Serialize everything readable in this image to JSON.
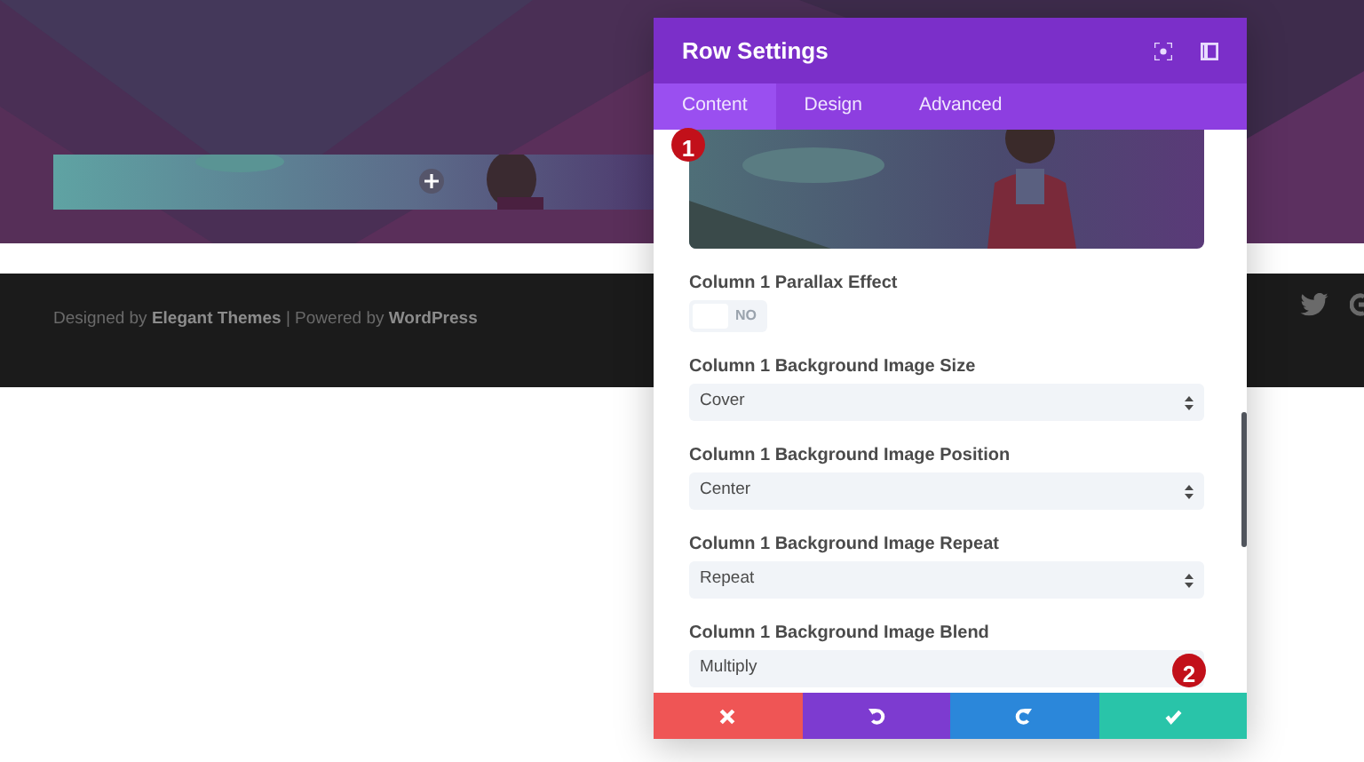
{
  "page": {
    "footer_text": "Designed by **Elegant Themes** | Powered by **WordPress**"
  },
  "modal": {
    "title": "Row Settings",
    "tabs": [
      {
        "label": "Content",
        "selected": true
      },
      {
        "label": "Design",
        "selected": false
      },
      {
        "label": "Advanced",
        "selected": false
      }
    ],
    "parallax": {
      "label": "Column 1 Parallax Effect",
      "on": false,
      "state_text": "NO"
    },
    "selects": [
      {
        "label": "Column 1 Background Image Size",
        "value": "Cover"
      },
      {
        "label": "Column 1 Background Image Position",
        "value": "Center"
      },
      {
        "label": "Column 1 Background Image Repeat",
        "value": "Repeat"
      },
      {
        "label": "Column 1 Background Image Blend",
        "value": "Multiply"
      }
    ],
    "markers": [
      "1",
      "2"
    ],
    "actions": [
      {
        "kind": "cancel"
      },
      {
        "kind": "undo"
      },
      {
        "kind": "redo"
      },
      {
        "kind": "save"
      }
    ]
  }
}
